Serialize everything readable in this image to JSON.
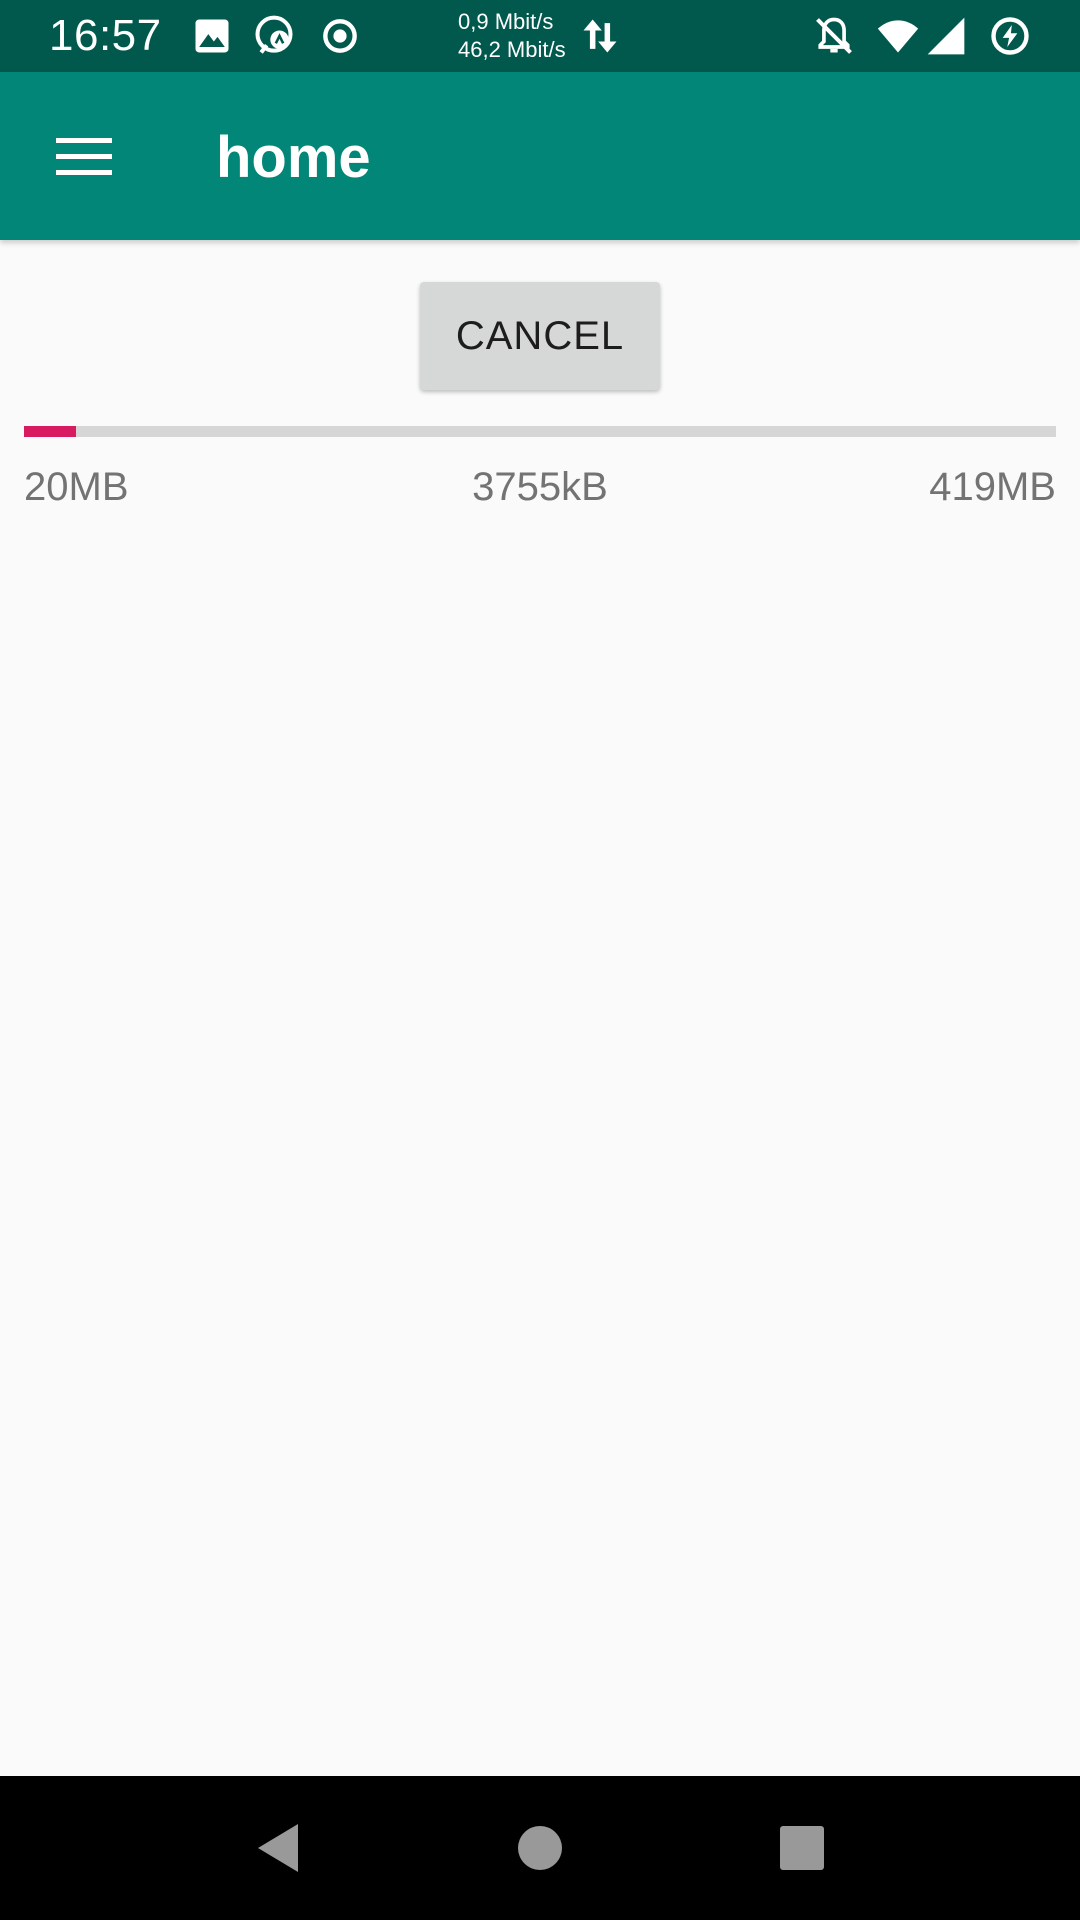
{
  "status_bar": {
    "time": "16:57",
    "upload_speed": "0,9 Mbit/s",
    "download_speed": "46,2 Mbit/s",
    "left_icons": [
      "image-icon",
      "messenger-icon",
      "record-icon"
    ],
    "right_icons": [
      "transfer-arrows-icon",
      "notifications-off-icon",
      "wifi-icon",
      "cell-signal-icon",
      "battery-saver-icon"
    ]
  },
  "app_bar": {
    "title": "home",
    "menu_icon": "hamburger-menu-icon"
  },
  "download": {
    "cancel_label": "CANCEL",
    "progress_percent": 5,
    "downloaded_label": "20MB",
    "speed_label": "3755kB",
    "total_label": "419MB"
  },
  "nav_bar": {
    "icons": [
      "back-icon",
      "home-icon",
      "recents-icon"
    ]
  },
  "colors": {
    "status_bar": "#00594c",
    "app_bar": "#028677",
    "progress_fill": "#d81b60",
    "progress_track": "#d6d6d6",
    "background": "#fafafa"
  }
}
